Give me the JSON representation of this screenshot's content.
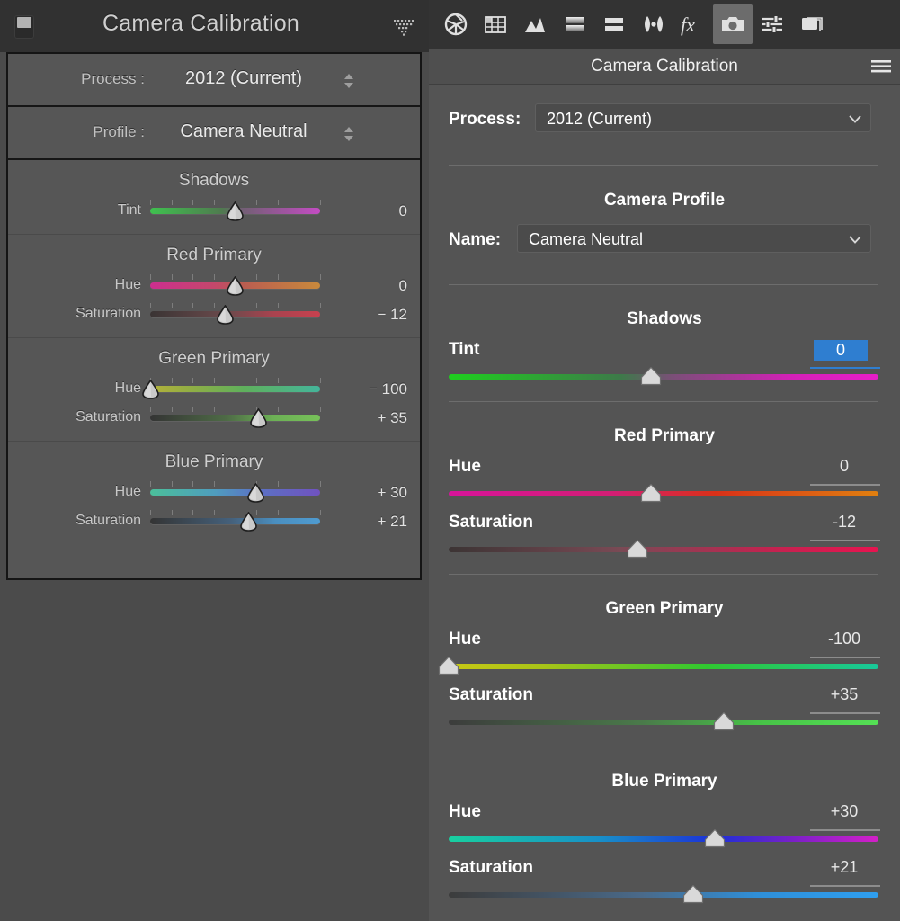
{
  "left_panel": {
    "title": "Camera Calibration",
    "toggle_icon": "panel-switch-icon",
    "collapse_icon": "dotted-triangle-icon",
    "rows": [
      {
        "label": "Process :",
        "value": "2012 (Current)",
        "stepper_icon": "stepper-arrows-icon"
      },
      {
        "label": "Profile :",
        "value": "Camera Neutral",
        "stepper_icon": "stepper-arrows-icon"
      }
    ],
    "sections": [
      {
        "title": "Shadows",
        "sliders": [
          {
            "label": "Tint",
            "value": "0",
            "pos": 50,
            "grad": "linear-gradient(to right,#3fc14f 0%,#4f7b4f 42%,#6e6070 52%,#c44cc4 100%)"
          }
        ]
      },
      {
        "title": "Red Primary",
        "sliders": [
          {
            "label": "Hue",
            "value": "0",
            "pos": 50,
            "grad": "linear-gradient(to right,#cc2e8f 0%,#c4486b 38%,#b95a52 52%,#c98a3c 100%)"
          },
          {
            "label": "Saturation",
            "value": "− 12",
            "pos": 44,
            "grad": "linear-gradient(to right,#3a3434 0%,#6b4a4c 45%,#a8434f 72%,#c8414f 100%)"
          }
        ]
      },
      {
        "title": "Green Primary",
        "sliders": [
          {
            "label": "Hue",
            "value": "− 100",
            "pos": 0,
            "grad": "linear-gradient(to right,#b3b03a 0%,#8fae45 25%,#5fb05c 55%,#44b59b 100%)"
          },
          {
            "label": "Saturation",
            "value": "+ 35",
            "pos": 64,
            "grad": "linear-gradient(to right,#343434 0%,#4e6b46 45%,#6cb055 72%,#77c159 100%)"
          }
        ]
      },
      {
        "title": "Blue Primary",
        "sliders": [
          {
            "label": "Hue",
            "value": "+ 30",
            "pos": 62,
            "grad": "linear-gradient(to right,#4bbf9a 0%,#4f9dbe 38%,#5a73c4 62%,#7052bf 100%)"
          },
          {
            "label": "Saturation",
            "value": "+ 21",
            "pos": 58,
            "grad": "linear-gradient(to right,#343434 0%,#45617c 48%,#4a8fc0 74%,#4f9bd0 100%)"
          }
        ]
      }
    ]
  },
  "right_panel": {
    "header_title": "Camera Calibration",
    "menu_icon": "hamburger-menu-icon",
    "toolbar": [
      {
        "icon": "aperture-basic-icon",
        "active": false
      },
      {
        "icon": "detail-grid-icon",
        "active": false
      },
      {
        "icon": "tone-curve-icon",
        "active": false
      },
      {
        "icon": "hsl-grayscale-icon",
        "active": false
      },
      {
        "icon": "split-toning-icon",
        "active": false
      },
      {
        "icon": "lens-corrections-icon",
        "active": false
      },
      {
        "icon": "effects-fx-icon",
        "active": false
      },
      {
        "icon": "camera-calibration-icon",
        "active": true
      },
      {
        "icon": "presets-sliders-icon",
        "active": false
      },
      {
        "icon": "snapshots-icon",
        "active": false
      }
    ],
    "process_label": "Process:",
    "process_value": "2012 (Current)",
    "profile_section_title": "Camera Profile",
    "profile_name_label": "Name:",
    "profile_name_value": "Camera Neutral",
    "chevron_icon": "chevron-down-icon",
    "sections": [
      {
        "title": "Shadows",
        "sliders": [
          {
            "label": "Tint",
            "value": "0",
            "pos": 47,
            "selected": true,
            "grad": "linear-gradient(to right,#1ed01e 0%,#3d7a49 40%,#7a4f77 52%,#d420b8 80%,#e81ec8 100%)"
          }
        ]
      },
      {
        "title": "Red Primary",
        "sliders": [
          {
            "label": "Hue",
            "value": "0",
            "pos": 47,
            "selected": false,
            "grad": "linear-gradient(to right,#d6149a 0%,#d41e75 38%,#d93018 62%,#e08010 100%)"
          },
          {
            "label": "Saturation",
            "value": "-12",
            "pos": 44,
            "selected": false,
            "grad": "linear-gradient(to right,#3c3434 0%,#7a4a55 40%,#c32350 75%,#e81450 100%)"
          }
        ]
      },
      {
        "title": "Green Primary",
        "sliders": [
          {
            "label": "Hue",
            "value": "-100",
            "pos": 0,
            "selected": false,
            "grad": "linear-gradient(to right,#c8c814 0%,#a8c418 22%,#30c830 60%,#18c89a 100%)"
          },
          {
            "label": "Saturation",
            "value": "+35",
            "pos": 64,
            "selected": false,
            "grad": "linear-gradient(to right,#3c3c3c 0%,#4a7a4a 45%,#47c247 72%,#55e055 100%)"
          }
        ]
      },
      {
        "title": "Blue Primary",
        "sliders": [
          {
            "label": "Hue",
            "value": "+30",
            "pos": 62,
            "selected": false,
            "grad": "linear-gradient(to right,#18d0a0 0%,#1890c8 35%,#1c30d8 62%,#7a20c8 80%,#d420c8 100%)"
          },
          {
            "label": "Saturation",
            "value": "+21",
            "pos": 57,
            "selected": false,
            "grad": "linear-gradient(to right,#3c3c3c 0%,#4a6a8a 45%,#2f8fd8 72%,#2f9ff0 100%)"
          }
        ]
      }
    ]
  },
  "colors": {
    "left_panel_bg": "#4b4b4b",
    "left_body_bg": "#565656",
    "left_header_bg": "#313131",
    "right_panel_bg": "#545454",
    "right_toolbar_bg": "#333333",
    "accent_selection": "#2f7ed0"
  }
}
